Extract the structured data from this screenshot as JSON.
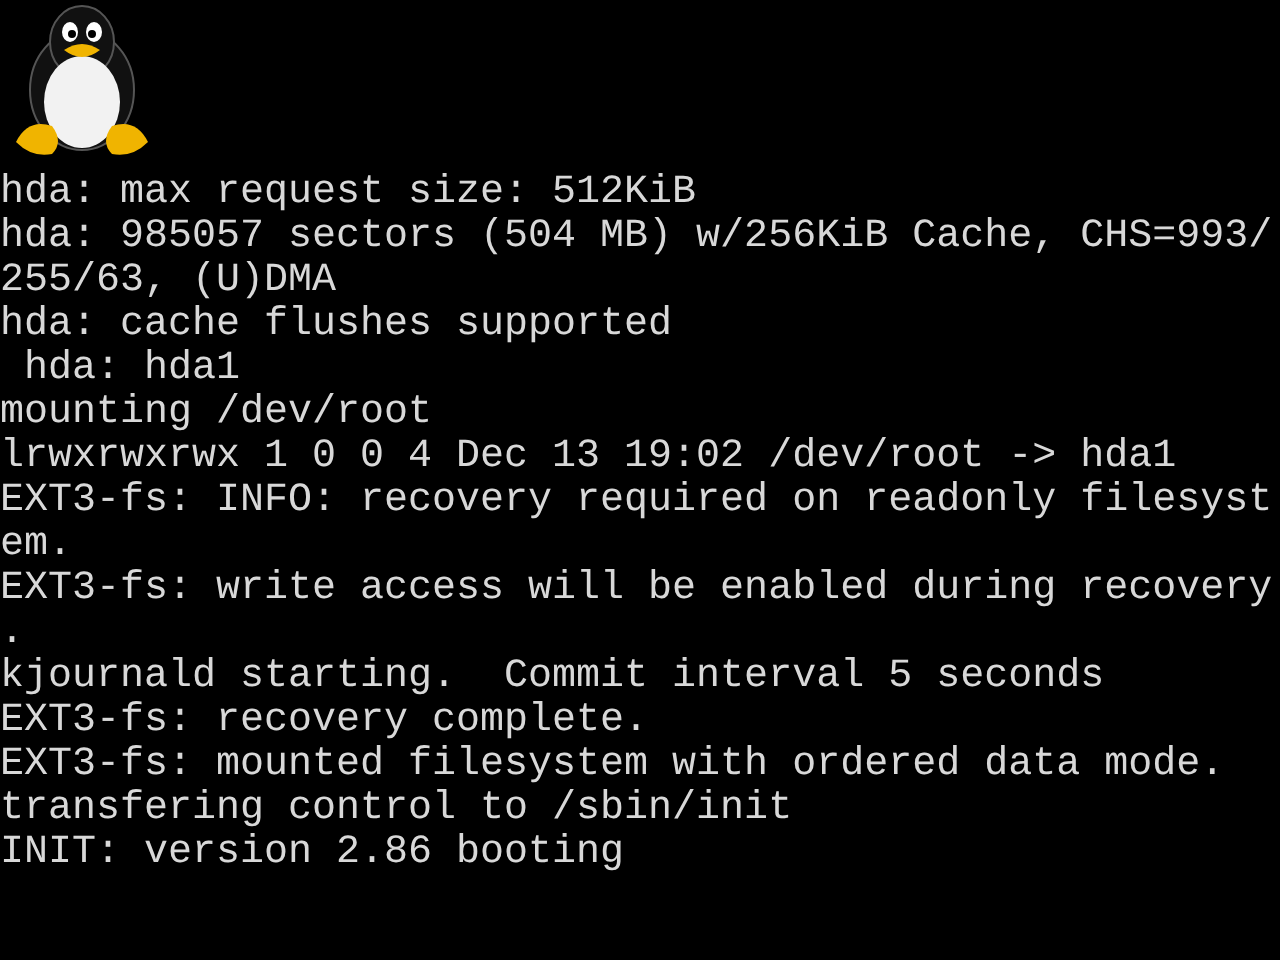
{
  "console_lines": [
    "hda: max request size: 512KiB",
    "hda: 985057 sectors (504 MB) w/256KiB Cache, CHS=993/",
    "255/63, (U)DMA",
    "hda: cache flushes supported",
    " hda: hda1",
    "mounting /dev/root",
    "lrwxrwxrwx 1 0 0 4 Dec 13 19:02 /dev/root -> hda1",
    "EXT3-fs: INFO: recovery required on readonly filesyst",
    "em.",
    "EXT3-fs: write access will be enabled during recovery",
    ".",
    "kjournald starting.  Commit interval 5 seconds",
    "EXT3-fs: recovery complete.",
    "EXT3-fs: mounted filesystem with ordered data mode.",
    "transfering control to /sbin/init",
    "INIT: version 2.86 booting"
  ]
}
